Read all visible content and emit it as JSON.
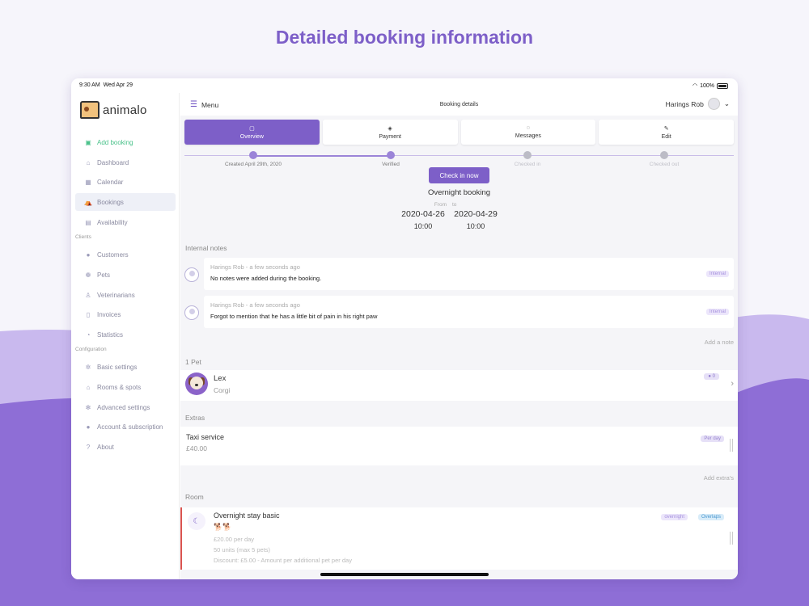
{
  "headline": "Detailed booking information",
  "status": {
    "time": "9:30 AM",
    "date": "Wed Apr 29",
    "battery": "100%"
  },
  "sidebar": {
    "logo_text": "animalo",
    "add_booking": "Add booking",
    "items": [
      "Dashboard",
      "Calendar",
      "Bookings",
      "Availability"
    ],
    "clients_label": "Clients",
    "client_items": [
      "Customers",
      "Pets",
      "Veterinarians",
      "Invoices",
      "Statistics"
    ],
    "config_label": "Configuration",
    "config_items": [
      "Basic settings",
      "Rooms & spots",
      "Advanced settings",
      "Account & subscription",
      "About"
    ]
  },
  "topbar": {
    "menu": "Menu",
    "title": "Booking details",
    "user": "Harings Rob"
  },
  "tabs": [
    "Overview",
    "Payment",
    "Messages",
    "Edit"
  ],
  "progress": {
    "steps": [
      "Created April 29th, 2020",
      "Verified",
      "Checked in",
      "Checked out"
    ],
    "completed_fraction": 0.5
  },
  "checkin_button": "Check in now",
  "booking": {
    "type": "Overnight booking",
    "from_label": "From",
    "to_label": "to",
    "from_date": "2020-04-26",
    "to_date": "2020-04-29",
    "from_time": "10:00",
    "to_time": "10:00"
  },
  "notes": {
    "label": "Internal notes",
    "items": [
      {
        "author": "Harings Rob",
        "time": " - a few seconds ago",
        "text": "No notes were added during the booking.",
        "tag": "Internal"
      },
      {
        "author": "Harings Rob",
        "time": " - a few seconds ago",
        "text": "Forgot to mention that he has a little bit of pain in his right paw",
        "tag": "Internal"
      }
    ],
    "add": "Add a note"
  },
  "pets": {
    "label": "1 Pet",
    "name": "Lex",
    "breed": "Corgi",
    "messages": "0"
  },
  "extras": {
    "label": "Extras",
    "name": "Taxi service",
    "price": "£40.00",
    "tag": "Per day",
    "add": "Add extra's"
  },
  "room": {
    "label": "Room",
    "name": "Overnight stay basic",
    "icons": "🐕🐕",
    "price": "£20.00 per day",
    "units": "50 units (max 5 pets)",
    "discount": "Discount: £5.00 - Amount per additional pet per day",
    "tags": [
      "overnight",
      "Overlaps"
    ]
  }
}
